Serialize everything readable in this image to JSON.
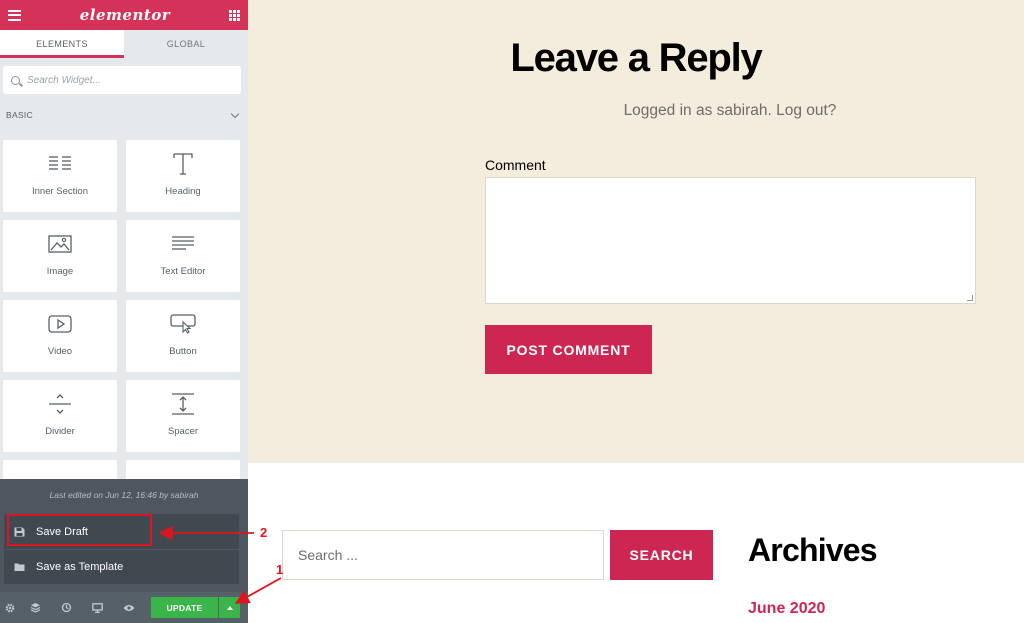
{
  "editor": {
    "logo_text": "elementor",
    "tabs": [
      {
        "label": "ELEMENTS",
        "active": true
      },
      {
        "label": "GLOBAL",
        "active": false
      }
    ],
    "search": {
      "placeholder": "Search Widget..."
    },
    "category": {
      "title": "BASIC"
    },
    "widgets": [
      {
        "label": "Inner Section",
        "icon": "inner-section-icon"
      },
      {
        "label": "Heading",
        "icon": "heading-icon"
      },
      {
        "label": "Image",
        "icon": "image-icon"
      },
      {
        "label": "Text Editor",
        "icon": "text-editor-icon"
      },
      {
        "label": "Video",
        "icon": "video-icon"
      },
      {
        "label": "Button",
        "icon": "button-icon"
      },
      {
        "label": "Divider",
        "icon": "divider-icon"
      },
      {
        "label": "Spacer",
        "icon": "spacer-icon"
      }
    ],
    "publish_menu": {
      "last_edited": "Last edited on Jun 12, 16:46 by sabirah",
      "items": [
        {
          "label": "Save Draft",
          "icon": "save-icon"
        },
        {
          "label": "Save as Template",
          "icon": "folder-icon"
        }
      ]
    },
    "bottom_bar": {
      "update_label": "UPDATE",
      "icons": [
        "settings-icon",
        "navigator-icon",
        "history-icon",
        "responsive-icon",
        "preview-icon"
      ]
    }
  },
  "page": {
    "reply_title": "Leave a Reply",
    "logged_in_text": "Logged in as sabirah. Log out?",
    "comment_label": "Comment",
    "post_comment_label": "POST COMMENT",
    "search_placeholder": "Search ...",
    "search_button_label": "SEARCH",
    "archives_title": "Archives",
    "archive_link": "June 2020"
  },
  "annotations": {
    "step_1": "1",
    "step_2": "2",
    "color": "#e0141e"
  },
  "colors": {
    "brand": "#d5325a",
    "accent": "#cd2653",
    "update_green": "#39b54a"
  }
}
